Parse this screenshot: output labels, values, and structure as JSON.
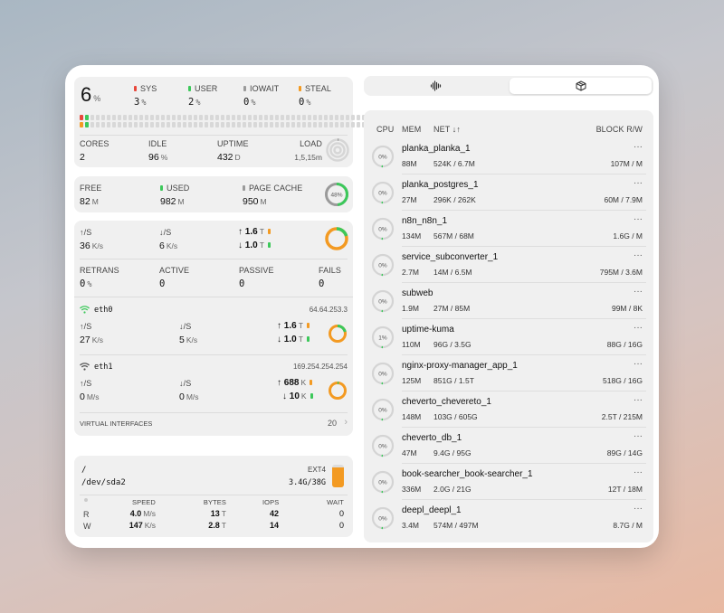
{
  "cpu": {
    "usage": "6",
    "usage_unit": "%",
    "sys": {
      "label": "SYS",
      "value": "3",
      "unit": "%"
    },
    "user": {
      "label": "USER",
      "value": "2",
      "unit": "%"
    },
    "iowait": {
      "label": "IOWAIT",
      "value": "0",
      "unit": "%"
    },
    "steal": {
      "label": "STEAL",
      "value": "0",
      "unit": "%"
    },
    "cores": {
      "label": "CORES",
      "value": "2"
    },
    "idle": {
      "label": "IDLE",
      "value": "96",
      "unit": "%"
    },
    "uptime": {
      "label": "UPTIME",
      "value": "432",
      "unit": "D"
    },
    "load": {
      "label": "LOAD",
      "value": "1,5,15m"
    },
    "colors": {
      "sys": "#e8473b",
      "user": "#3cc85a",
      "iowait": "#9a9a9a",
      "steal": "#f39a22"
    }
  },
  "memory": {
    "free": {
      "label": "FREE",
      "value": "82",
      "unit": "M"
    },
    "used": {
      "label": "USED",
      "value": "982",
      "unit": "M"
    },
    "cache": {
      "label": "PAGE CACHE",
      "value": "950",
      "unit": "M"
    },
    "percent": "48%",
    "percent_value": 48
  },
  "network": {
    "up": {
      "label": "↑/S",
      "value": "36",
      "unit": "K/s"
    },
    "down": {
      "label": "↓/S",
      "value": "6",
      "unit": "K/s"
    },
    "total_up": {
      "arrow": "↑",
      "value": "1.6",
      "unit": "T"
    },
    "total_down": {
      "arrow": "↓",
      "value": "1.0",
      "unit": "T"
    },
    "retrans": {
      "label": "RETRANS",
      "value": "0",
      "unit": "%"
    },
    "active": {
      "label": "ACTIVE",
      "value": "0"
    },
    "passive": {
      "label": "PASSIVE",
      "value": "0"
    },
    "fails": {
      "label": "FAILS",
      "value": "0"
    },
    "interfaces": [
      {
        "name": "eth0",
        "ip": "64.64.253.3",
        "up_label": "↑/S",
        "up": "27",
        "up_unit": "K/s",
        "down_label": "↓/S",
        "down": "5",
        "down_unit": "K/s",
        "tx": "1.6",
        "tx_unit": "T",
        "rx": "1.0",
        "rx_unit": "T"
      },
      {
        "name": "eth1",
        "ip": "169.254.254.254",
        "up_label": "↑/S",
        "up": "0",
        "up_unit": "M/s",
        "down_label": "↓/S",
        "down": "0",
        "down_unit": "M/s",
        "tx": "688",
        "tx_unit": "K",
        "rx": "10",
        "rx_unit": "K"
      }
    ],
    "virtual": {
      "label": "VIRTUAL INTERFACES",
      "count": "20"
    }
  },
  "disk": {
    "mount": "/",
    "device": "/dev/sda2",
    "fs": "EXT4",
    "usage": "3.4G/38G",
    "fill": 0.9,
    "headers": [
      "SPEED",
      "BYTES",
      "IOPS",
      "WAIT"
    ],
    "read": {
      "label": "R",
      "speed": "4.0",
      "speed_unit": "M/s",
      "bytes": "13",
      "bytes_unit": "T",
      "iops": "42",
      "wait": "0"
    },
    "write": {
      "label": "W",
      "speed": "147",
      "speed_unit": "K/s",
      "bytes": "2.8",
      "bytes_unit": "T",
      "iops": "14",
      "wait": "0"
    }
  },
  "tabs": [
    {
      "icon": "waveform-icon"
    },
    {
      "icon": "cube-icon"
    }
  ],
  "containers": {
    "headers": {
      "cpu": "CPU",
      "mem": "MEM",
      "net": "NET ↓↑",
      "block": "BLOCK R/W"
    },
    "more": "···",
    "items": [
      {
        "name": "planka_planka_1",
        "cpu": "0%",
        "mem": "88M",
        "net": "524K / 6.7M",
        "block": "107M / M"
      },
      {
        "name": "planka_postgres_1",
        "cpu": "0%",
        "mem": "27M",
        "net": "296K / 262K",
        "block": "60M / 7.9M"
      },
      {
        "name": "n8n_n8n_1",
        "cpu": "0%",
        "mem": "134M",
        "net": "567M / 68M",
        "block": "1.6G / M"
      },
      {
        "name": "service_subconverter_1",
        "cpu": "0%",
        "mem": "2.7M",
        "net": "14M / 6.5M",
        "block": "795M / 3.6M"
      },
      {
        "name": "subweb",
        "cpu": "0%",
        "mem": "1.9M",
        "net": "27M / 85M",
        "block": "99M / 8K"
      },
      {
        "name": "uptime-kuma",
        "cpu": "1%",
        "mem": "110M",
        "net": "96G / 3.5G",
        "block": "88G / 16G"
      },
      {
        "name": "nginx-proxy-manager_app_1",
        "cpu": "0%",
        "mem": "125M",
        "net": "851G / 1.5T",
        "block": "518G / 16G"
      },
      {
        "name": "cheverto_chevereto_1",
        "cpu": "0%",
        "mem": "148M",
        "net": "103G / 605G",
        "block": "2.5T / 215M"
      },
      {
        "name": "cheverto_db_1",
        "cpu": "0%",
        "mem": "47M",
        "net": "9.4G / 95G",
        "block": "89G / 14G"
      },
      {
        "name": "book-searcher_book-searcher_1",
        "cpu": "0%",
        "mem": "336M",
        "net": "2.0G / 21G",
        "block": "12T / 18M"
      },
      {
        "name": "deepl_deepl_1",
        "cpu": "0%",
        "mem": "3.4M",
        "net": "574M / 497M",
        "block": "8.7G / M"
      }
    ]
  }
}
